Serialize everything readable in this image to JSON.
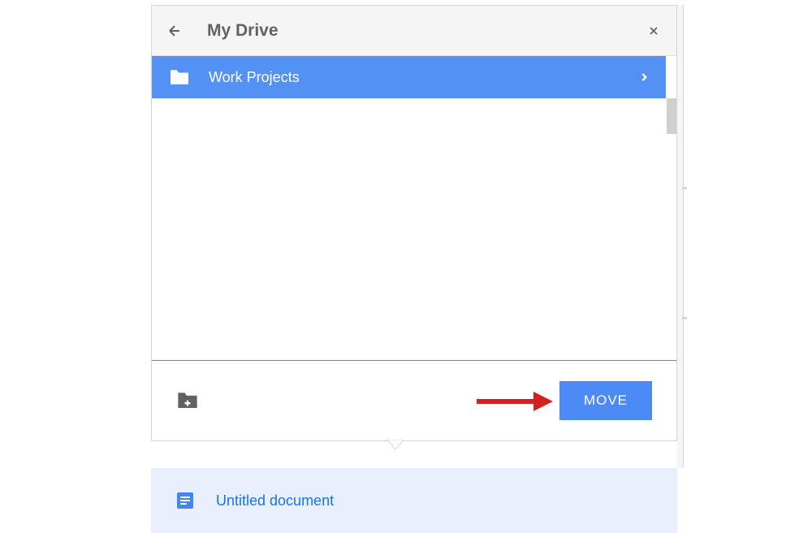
{
  "dialog": {
    "title": "My Drive",
    "folders": [
      {
        "name": "Work Projects"
      }
    ],
    "move_button_label": "MOVE"
  },
  "document": {
    "name": "Untitled document"
  }
}
